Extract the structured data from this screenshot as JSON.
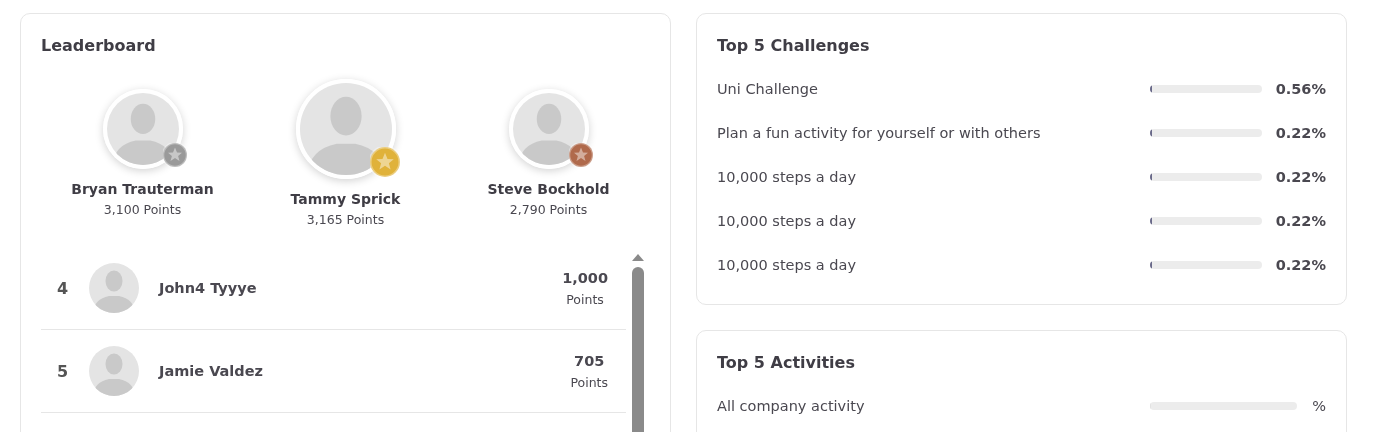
{
  "leaderboard": {
    "title": "Leaderboard",
    "podium": [
      {
        "name": "Bryan Trauterman",
        "points": "3,100 Points",
        "color": "#9a9a9a",
        "featured": false
      },
      {
        "name": "Tammy Sprick",
        "points": "3,165 Points",
        "color": "#e0b23a",
        "featured": true
      },
      {
        "name": "Steve Bockhold",
        "points": "2,790 Points",
        "color": "#b06a4c",
        "featured": false
      }
    ],
    "rows": [
      {
        "rank": "4",
        "name": "John4 Tyyye",
        "points": "1,000",
        "unit": "Points"
      },
      {
        "rank": "5",
        "name": "Jamie Valdez",
        "points": "705",
        "unit": "Points"
      }
    ]
  },
  "challenges": {
    "title": "Top 5 Challenges",
    "items": [
      {
        "label": "Uni Challenge",
        "level": 0.0056,
        "reading": "0.56%"
      },
      {
        "label": "Plan a fun activity for yourself or with others",
        "level": 0.0022,
        "reading": "0.22%"
      },
      {
        "label": "10,000 steps a day",
        "level": 0.0022,
        "reading": "0.22%"
      },
      {
        "label": "10,000 steps a day",
        "level": 0.0022,
        "reading": "0.22%"
      },
      {
        "label": "10,000 steps a day",
        "level": 0.0022,
        "reading": "0.22%"
      }
    ]
  },
  "activities": {
    "title": "Top 5 Activities",
    "items": [
      {
        "label": "All company activity",
        "level": 0,
        "reading": "%"
      }
    ]
  }
}
